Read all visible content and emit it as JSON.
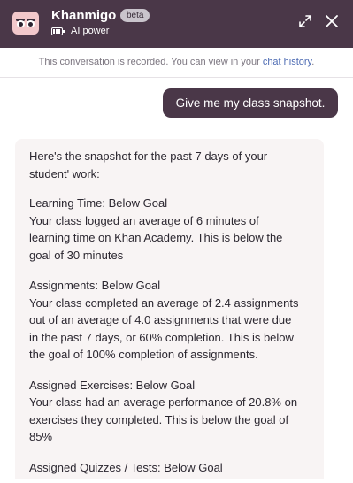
{
  "header": {
    "title": "Khanmigo",
    "badge": "beta",
    "power_label": "AI power",
    "colors": {
      "bar": "#4a3748",
      "avatar": "#f2c8cb"
    },
    "icons": [
      "khanmigo-avatar-icon",
      "battery-icon",
      "expand-icon",
      "close-icon"
    ]
  },
  "notice": {
    "text": "This conversation is recorded. You can view in your ",
    "link": "chat history",
    "suffix": "."
  },
  "user_message": "Give me my class snapshot.",
  "assistant": {
    "intro": [
      "Here's the snapshot for the past 7 days of your",
      "student' work:"
    ],
    "sections": [
      {
        "heading": "Learning Time: Below Goal",
        "lines": [
          "Your class logged an average of 6 minutes of",
          "learning time on Khan Academy. This is below the",
          "goal of 30 minutes"
        ]
      },
      {
        "heading": "Assignments: Below Goal",
        "lines": [
          "Your class completed an average of 2.4 assignments",
          "out of an average of 4.0 assignments that were due",
          "in the past 7 days, or 60% completion. This is below",
          "the goal of 100% completion of assignments."
        ]
      },
      {
        "heading": "Assigned Exercises: Below Goal",
        "lines": [
          "Your class had an average performance of 20.8% on",
          "exercises they completed. This is below the goal of",
          "85%"
        ]
      },
      {
        "heading": "Assigned Quizzes / Tests: Below Goal",
        "lines": []
      }
    ]
  }
}
